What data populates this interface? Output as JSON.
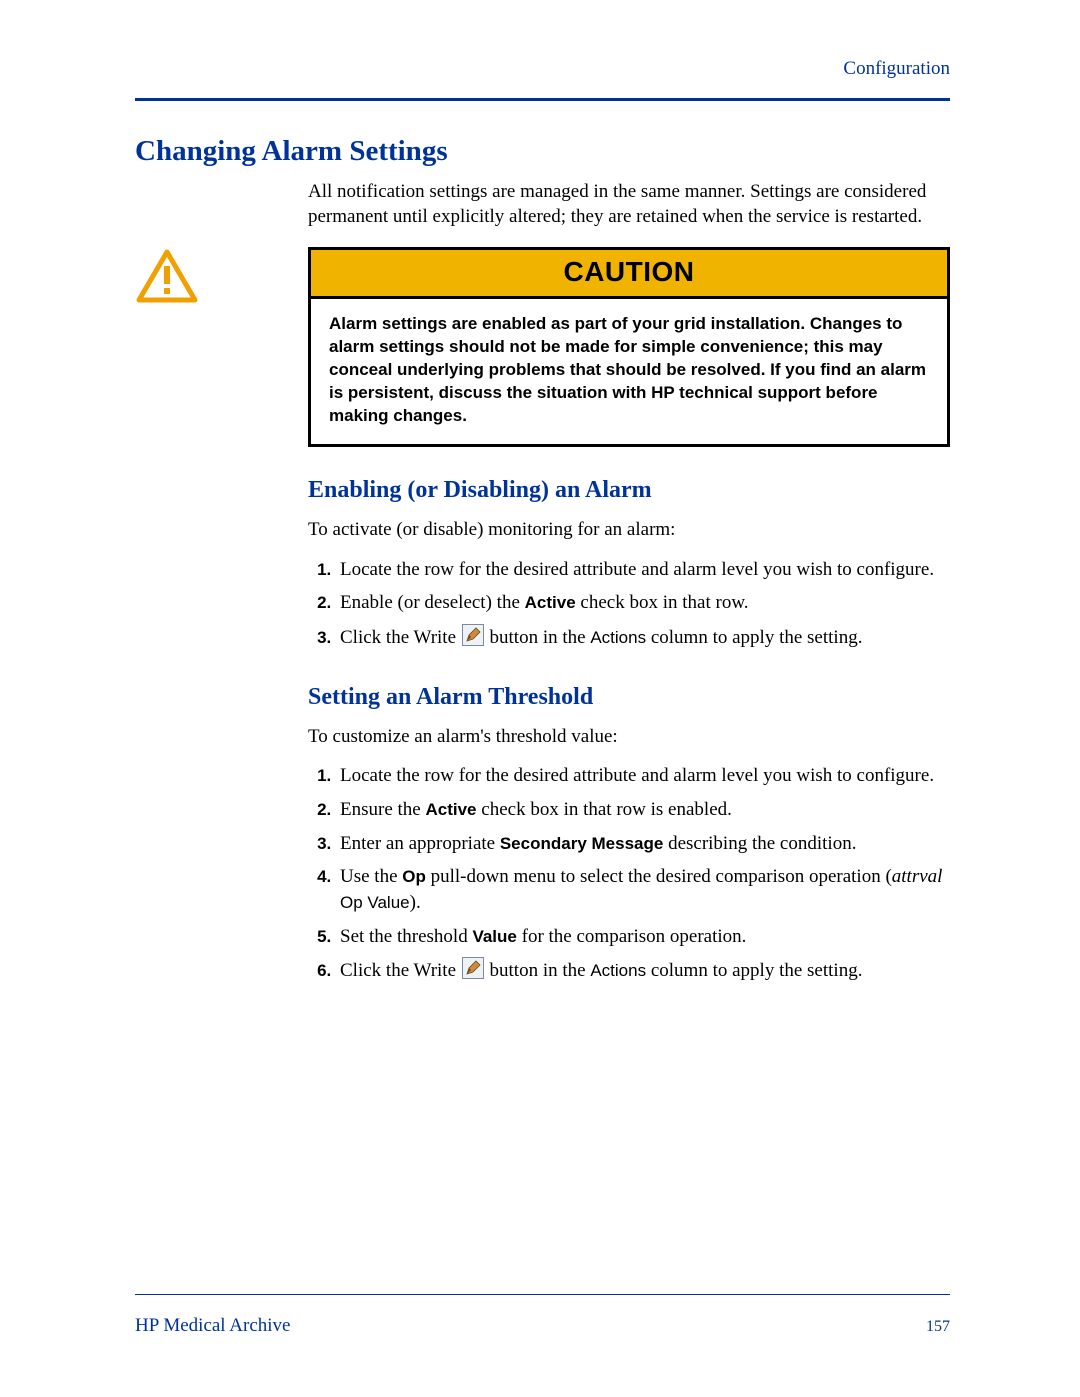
{
  "header": {
    "section": "Configuration"
  },
  "title": "Changing Alarm Settings",
  "intro": "All notification settings are managed in the same manner. Settings are considered permanent until explicitly altered; they are retained when the service is restarted.",
  "caution": {
    "label": "CAUTION",
    "text": "Alarm settings are enabled as part of your grid installation. Changes to alarm settings should not be made for simple convenience; this may conceal underlying problems that should be resolved. If you find an alarm is persistent, discuss the situation with HP technical support before making changes."
  },
  "sec1": {
    "heading": "Enabling (or Disabling) an Alarm",
    "intro": "To activate (or disable) monitoring for an alarm:",
    "steps": {
      "s1": "Locate the row for the desired attribute and alarm level you wish to configure.",
      "s2a": "Enable (or deselect) the ",
      "s2b": "Active",
      "s2c": " check box in that row.",
      "s3a": "Click the Write ",
      "s3b": " button in the ",
      "s3c": "Actions",
      "s3d": " column to apply the setting."
    }
  },
  "sec2": {
    "heading": "Setting an Alarm Threshold",
    "intro": "To customize an alarm's threshold value:",
    "steps": {
      "s1": "Locate the row for the desired attribute and alarm level you wish to configure.",
      "s2a": "Ensure the ",
      "s2b": "Active",
      "s2c": " check box in that row is enabled.",
      "s3a": "Enter an appropriate ",
      "s3b": "Secondary Message",
      "s3c": " describing the condition.",
      "s4a": "Use the ",
      "s4b": "Op",
      "s4c": " pull-down menu to select the desired comparison operation (",
      "s4d": "attrval",
      "s4e": " Op Value",
      "s4f": ").",
      "s5a": "Set the threshold ",
      "s5b": "Value",
      "s5c": " for the comparison operation.",
      "s6a": "Click the Write ",
      "s6b": " button in the ",
      "s6c": "Actions",
      "s6d": " column to apply the setting."
    }
  },
  "footer": {
    "left": "HP Medical Archive",
    "right": "157"
  }
}
